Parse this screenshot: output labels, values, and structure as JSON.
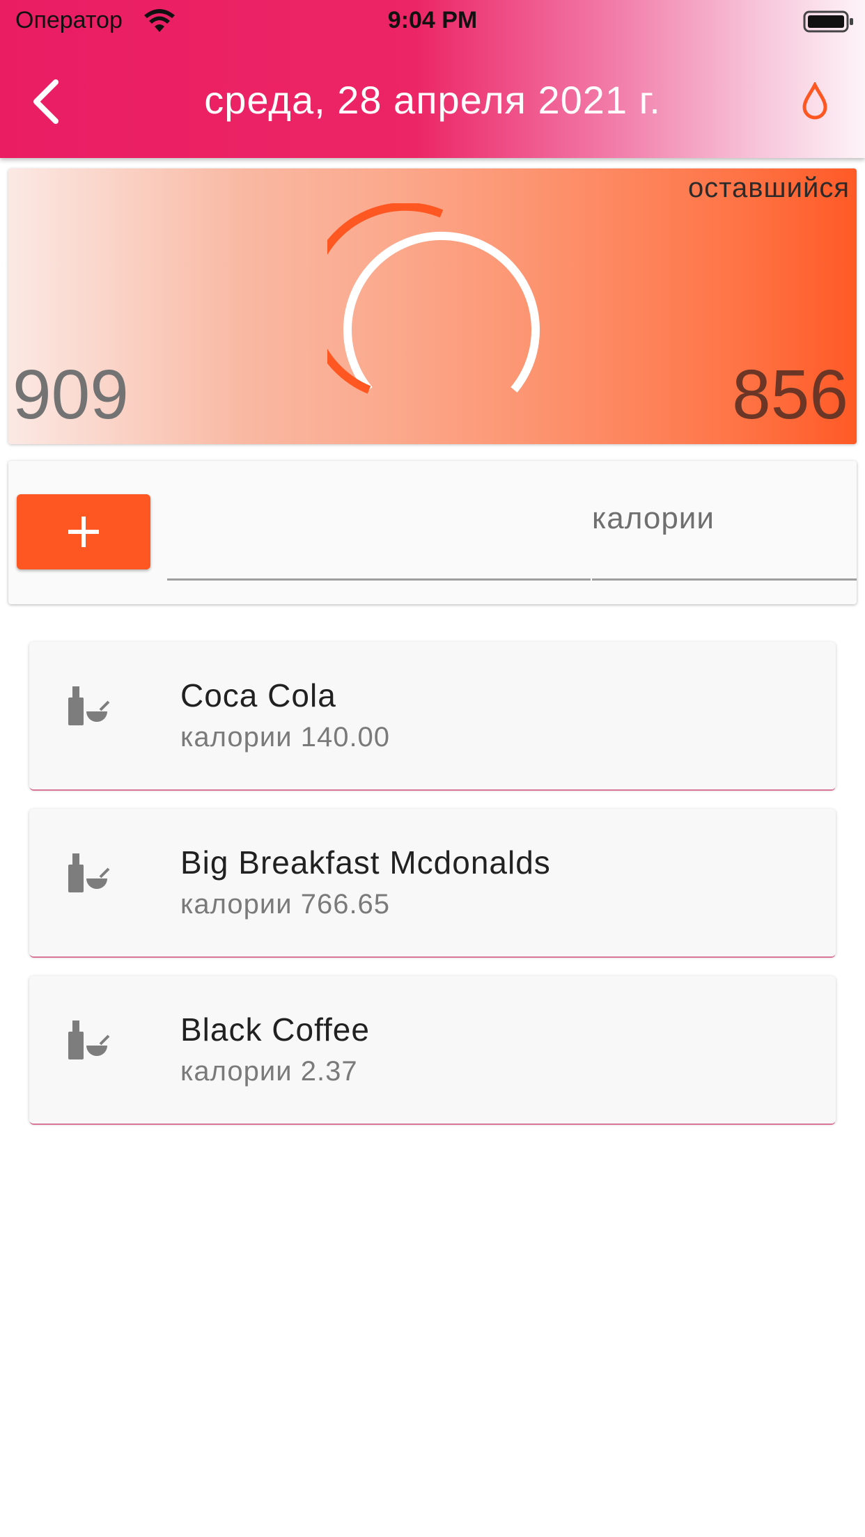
{
  "status_bar": {
    "carrier": "Оператор",
    "time": "9:04 PM",
    "wifi_icon": "wifi-icon",
    "battery_icon": "battery-icon"
  },
  "header": {
    "title": "среда, 28 апреля 2021 г.",
    "back_icon": "chevron-left-icon",
    "action_icon": "water-drop-icon",
    "background_color": "#ea1d63"
  },
  "summary": {
    "remaining_label": "оставшийся",
    "consumed": "909",
    "remaining": "856",
    "gauge_color": "#ff5722"
  },
  "entry": {
    "add_icon": "plus-icon",
    "food_value": "",
    "calories_label": "калории",
    "accent_color": "#ff5722"
  },
  "foods": [
    {
      "name": "Coca Cola",
      "calories": "калории 140.00",
      "icon": "food-drink-icon"
    },
    {
      "name": "Big Breakfast Mcdonalds",
      "calories": "калории 766.65",
      "icon": "food-drink-icon"
    },
    {
      "name": "Black Coffee",
      "calories": "калории 2.37",
      "icon": "food-drink-icon"
    }
  ]
}
